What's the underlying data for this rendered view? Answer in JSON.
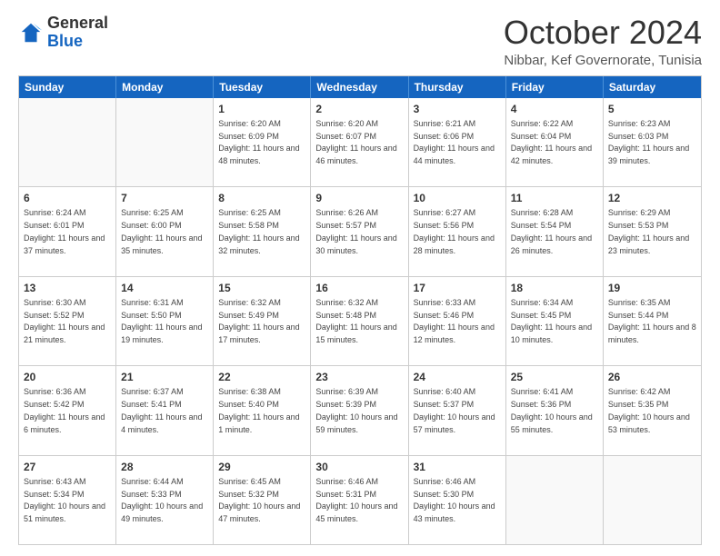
{
  "logo": {
    "general": "General",
    "blue": "Blue"
  },
  "header": {
    "month": "October 2024",
    "location": "Nibbar, Kef Governorate, Tunisia"
  },
  "days": [
    "Sunday",
    "Monday",
    "Tuesday",
    "Wednesday",
    "Thursday",
    "Friday",
    "Saturday"
  ],
  "weeks": [
    [
      {
        "day": "",
        "empty": true
      },
      {
        "day": "",
        "empty": true
      },
      {
        "day": "1",
        "sunrise": "Sunrise: 6:20 AM",
        "sunset": "Sunset: 6:09 PM",
        "daylight": "Daylight: 11 hours and 48 minutes."
      },
      {
        "day": "2",
        "sunrise": "Sunrise: 6:20 AM",
        "sunset": "Sunset: 6:07 PM",
        "daylight": "Daylight: 11 hours and 46 minutes."
      },
      {
        "day": "3",
        "sunrise": "Sunrise: 6:21 AM",
        "sunset": "Sunset: 6:06 PM",
        "daylight": "Daylight: 11 hours and 44 minutes."
      },
      {
        "day": "4",
        "sunrise": "Sunrise: 6:22 AM",
        "sunset": "Sunset: 6:04 PM",
        "daylight": "Daylight: 11 hours and 42 minutes."
      },
      {
        "day": "5",
        "sunrise": "Sunrise: 6:23 AM",
        "sunset": "Sunset: 6:03 PM",
        "daylight": "Daylight: 11 hours and 39 minutes."
      }
    ],
    [
      {
        "day": "6",
        "sunrise": "Sunrise: 6:24 AM",
        "sunset": "Sunset: 6:01 PM",
        "daylight": "Daylight: 11 hours and 37 minutes."
      },
      {
        "day": "7",
        "sunrise": "Sunrise: 6:25 AM",
        "sunset": "Sunset: 6:00 PM",
        "daylight": "Daylight: 11 hours and 35 minutes."
      },
      {
        "day": "8",
        "sunrise": "Sunrise: 6:25 AM",
        "sunset": "Sunset: 5:58 PM",
        "daylight": "Daylight: 11 hours and 32 minutes."
      },
      {
        "day": "9",
        "sunrise": "Sunrise: 6:26 AM",
        "sunset": "Sunset: 5:57 PM",
        "daylight": "Daylight: 11 hours and 30 minutes."
      },
      {
        "day": "10",
        "sunrise": "Sunrise: 6:27 AM",
        "sunset": "Sunset: 5:56 PM",
        "daylight": "Daylight: 11 hours and 28 minutes."
      },
      {
        "day": "11",
        "sunrise": "Sunrise: 6:28 AM",
        "sunset": "Sunset: 5:54 PM",
        "daylight": "Daylight: 11 hours and 26 minutes."
      },
      {
        "day": "12",
        "sunrise": "Sunrise: 6:29 AM",
        "sunset": "Sunset: 5:53 PM",
        "daylight": "Daylight: 11 hours and 23 minutes."
      }
    ],
    [
      {
        "day": "13",
        "sunrise": "Sunrise: 6:30 AM",
        "sunset": "Sunset: 5:52 PM",
        "daylight": "Daylight: 11 hours and 21 minutes."
      },
      {
        "day": "14",
        "sunrise": "Sunrise: 6:31 AM",
        "sunset": "Sunset: 5:50 PM",
        "daylight": "Daylight: 11 hours and 19 minutes."
      },
      {
        "day": "15",
        "sunrise": "Sunrise: 6:32 AM",
        "sunset": "Sunset: 5:49 PM",
        "daylight": "Daylight: 11 hours and 17 minutes."
      },
      {
        "day": "16",
        "sunrise": "Sunrise: 6:32 AM",
        "sunset": "Sunset: 5:48 PM",
        "daylight": "Daylight: 11 hours and 15 minutes."
      },
      {
        "day": "17",
        "sunrise": "Sunrise: 6:33 AM",
        "sunset": "Sunset: 5:46 PM",
        "daylight": "Daylight: 11 hours and 12 minutes."
      },
      {
        "day": "18",
        "sunrise": "Sunrise: 6:34 AM",
        "sunset": "Sunset: 5:45 PM",
        "daylight": "Daylight: 11 hours and 10 minutes."
      },
      {
        "day": "19",
        "sunrise": "Sunrise: 6:35 AM",
        "sunset": "Sunset: 5:44 PM",
        "daylight": "Daylight: 11 hours and 8 minutes."
      }
    ],
    [
      {
        "day": "20",
        "sunrise": "Sunrise: 6:36 AM",
        "sunset": "Sunset: 5:42 PM",
        "daylight": "Daylight: 11 hours and 6 minutes."
      },
      {
        "day": "21",
        "sunrise": "Sunrise: 6:37 AM",
        "sunset": "Sunset: 5:41 PM",
        "daylight": "Daylight: 11 hours and 4 minutes."
      },
      {
        "day": "22",
        "sunrise": "Sunrise: 6:38 AM",
        "sunset": "Sunset: 5:40 PM",
        "daylight": "Daylight: 11 hours and 1 minute."
      },
      {
        "day": "23",
        "sunrise": "Sunrise: 6:39 AM",
        "sunset": "Sunset: 5:39 PM",
        "daylight": "Daylight: 10 hours and 59 minutes."
      },
      {
        "day": "24",
        "sunrise": "Sunrise: 6:40 AM",
        "sunset": "Sunset: 5:37 PM",
        "daylight": "Daylight: 10 hours and 57 minutes."
      },
      {
        "day": "25",
        "sunrise": "Sunrise: 6:41 AM",
        "sunset": "Sunset: 5:36 PM",
        "daylight": "Daylight: 10 hours and 55 minutes."
      },
      {
        "day": "26",
        "sunrise": "Sunrise: 6:42 AM",
        "sunset": "Sunset: 5:35 PM",
        "daylight": "Daylight: 10 hours and 53 minutes."
      }
    ],
    [
      {
        "day": "27",
        "sunrise": "Sunrise: 6:43 AM",
        "sunset": "Sunset: 5:34 PM",
        "daylight": "Daylight: 10 hours and 51 minutes."
      },
      {
        "day": "28",
        "sunrise": "Sunrise: 6:44 AM",
        "sunset": "Sunset: 5:33 PM",
        "daylight": "Daylight: 10 hours and 49 minutes."
      },
      {
        "day": "29",
        "sunrise": "Sunrise: 6:45 AM",
        "sunset": "Sunset: 5:32 PM",
        "daylight": "Daylight: 10 hours and 47 minutes."
      },
      {
        "day": "30",
        "sunrise": "Sunrise: 6:46 AM",
        "sunset": "Sunset: 5:31 PM",
        "daylight": "Daylight: 10 hours and 45 minutes."
      },
      {
        "day": "31",
        "sunrise": "Sunrise: 6:46 AM",
        "sunset": "Sunset: 5:30 PM",
        "daylight": "Daylight: 10 hours and 43 minutes."
      },
      {
        "day": "",
        "empty": true
      },
      {
        "day": "",
        "empty": true
      }
    ]
  ]
}
